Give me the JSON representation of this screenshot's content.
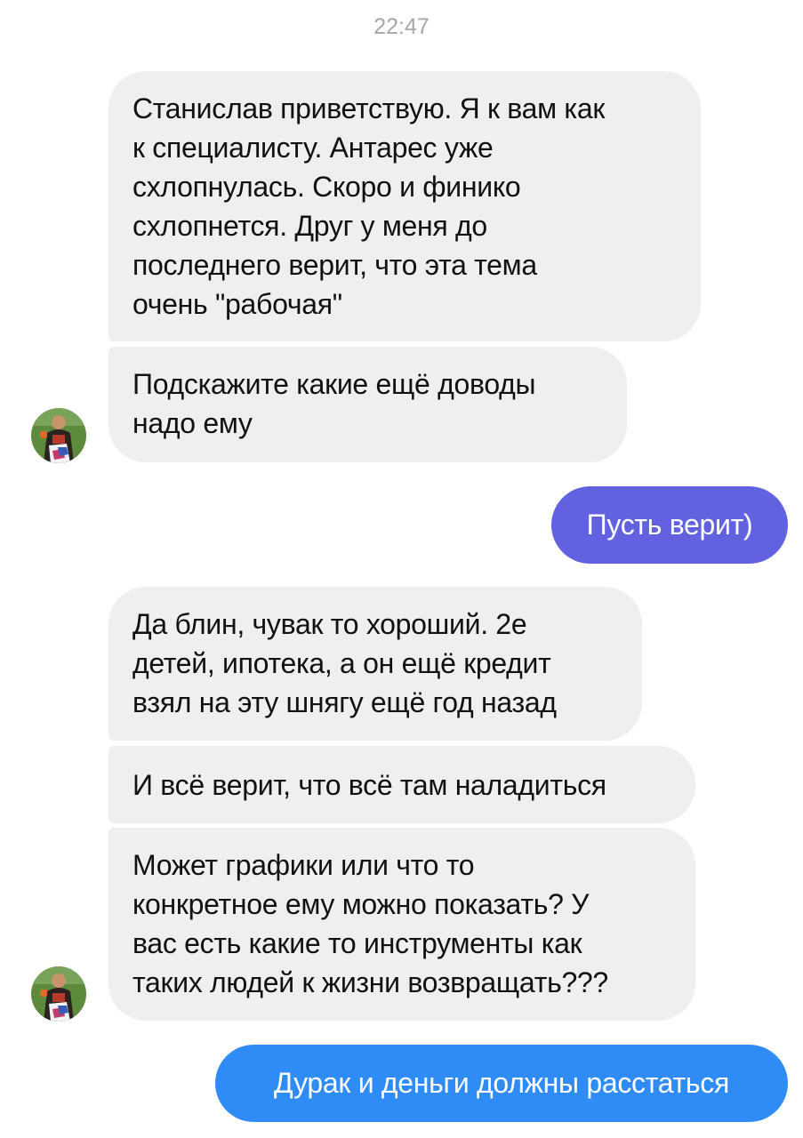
{
  "chat": {
    "timestamp": "22:47",
    "messages": [
      {
        "direction": "incoming",
        "text": "Станислав приветствую. Я к вам как\nк специалисту. Антарес уже\nсхлопнулась. Скоро и финико\nсхлопнется. Друг у меня до\nпоследнего верит, что эта тема\nочень \"рабочая\""
      },
      {
        "direction": "incoming",
        "text": "Подскажите какие ещё доводы\nнадо ему"
      },
      {
        "direction": "outgoing",
        "text": "Пусть верит)"
      },
      {
        "direction": "incoming",
        "text": "Да блин, чувак то хороший. 2е\nдетей, ипотека, а он ещё кредит\nвзял на эту шнягу ещё год назад"
      },
      {
        "direction": "incoming",
        "text": "И всё верит, что всё там наладиться"
      },
      {
        "direction": "incoming",
        "text": "Может графики или что то\nконкретное ему можно показать? У\nвас есть какие то инструменты как\nтаких людей к жизни возвращать???"
      },
      {
        "direction": "outgoing",
        "text": "Дурак и деньги должны расстаться"
      }
    ]
  },
  "colors": {
    "incoming_bubble": "#efeff0",
    "outgoing_purple": "#6262e0",
    "outgoing_blue": "#2f8cf6",
    "timestamp": "#a7a7ab"
  }
}
